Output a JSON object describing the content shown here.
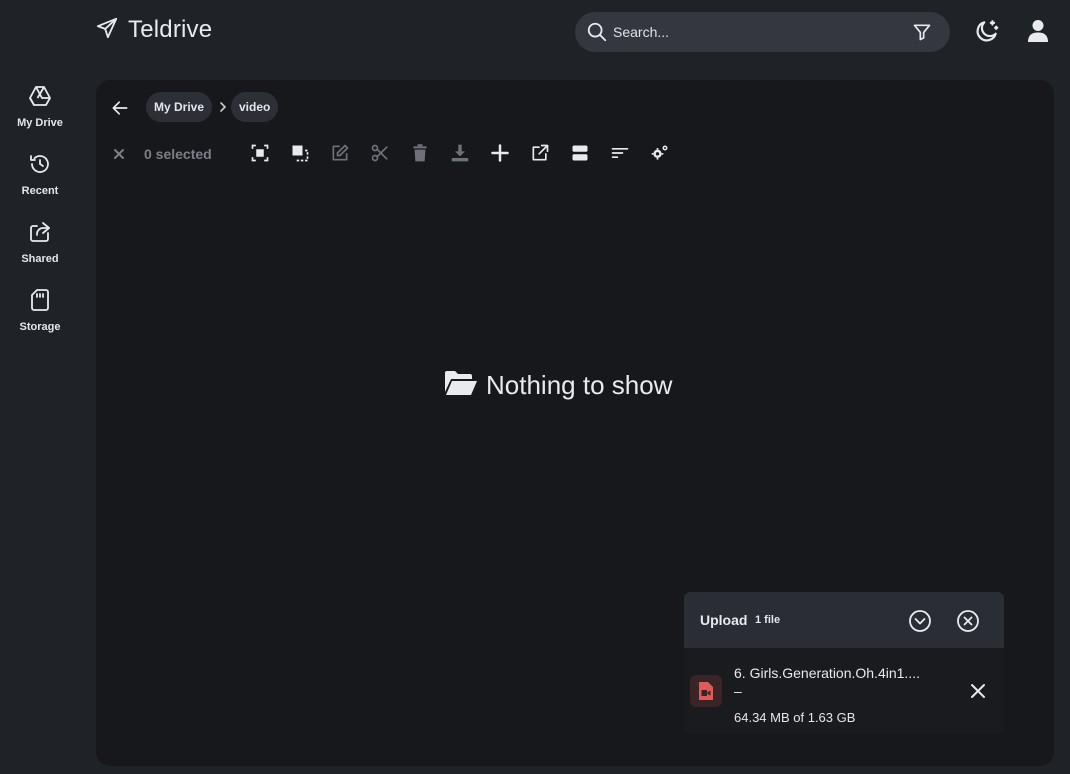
{
  "app": {
    "title": "Teldrive"
  },
  "search": {
    "placeholder": "Search..."
  },
  "sidebar": {
    "items": [
      {
        "label": "My Drive",
        "icon": "drive-icon"
      },
      {
        "label": "Recent",
        "icon": "history-icon"
      },
      {
        "label": "Shared",
        "icon": "share-icon"
      },
      {
        "label": "Storage",
        "icon": "sd-card-icon"
      }
    ]
  },
  "breadcrumb": {
    "items": [
      "My Drive",
      "video"
    ]
  },
  "toolbar": {
    "selected_label": "0 selected"
  },
  "empty_state": {
    "text": "Nothing to show"
  },
  "upload": {
    "title": "Upload",
    "count_label": "1 file",
    "file": {
      "name": "6. Girls.Generation.Oh.4in1....",
      "name_cont": "–",
      "progress": "64.34 MB of 1.63 GB"
    }
  },
  "colors": {
    "background": "#1f2227",
    "panel": "#16181c",
    "file_icon": "#e05a5a"
  }
}
